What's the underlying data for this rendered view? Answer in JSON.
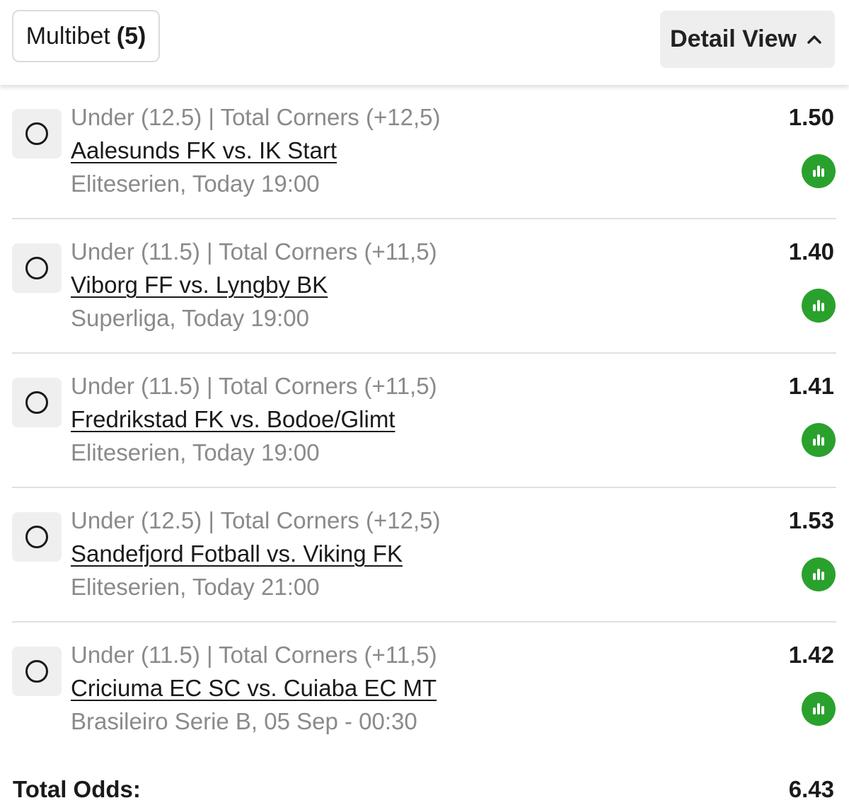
{
  "header": {
    "multibet_label": "Multibet",
    "multibet_count": "(5)",
    "detail_view_label": "Detail View",
    "detail_view_icon": "chevron-up-icon"
  },
  "bets": [
    {
      "selection": "Under (12.5) | Total Corners (+12,5)",
      "match": "Aalesunds FK vs. IK Start",
      "league": "Eliteserien, Today 19:00",
      "odds": "1.50"
    },
    {
      "selection": "Under (11.5) | Total Corners (+11,5)",
      "match": "Viborg FF vs. Lyngby BK",
      "league": "Superliga, Today 19:00",
      "odds": "1.40"
    },
    {
      "selection": "Under (11.5) | Total Corners (+11,5)",
      "match": "Fredrikstad FK vs. Bodoe/Glimt",
      "league": "Eliteserien, Today 19:00",
      "odds": "1.41"
    },
    {
      "selection": "Under (12.5) | Total Corners (+12,5)",
      "match": "Sandefjord Fotball vs. Viking FK",
      "league": "Eliteserien, Today 21:00",
      "odds": "1.53"
    },
    {
      "selection": "Under (11.5) | Total Corners (+11,5)",
      "match": "Criciuma EC SC vs. Cuiaba EC MT",
      "league": "Brasileiro Serie B, 05 Sep - 00:30",
      "odds": "1.42"
    }
  ],
  "footer": {
    "total_label": "Total Odds:",
    "total_value": "6.43"
  },
  "colors": {
    "stats_green": "#2aa12d",
    "muted_text": "#8a8a8a",
    "primary_text": "#1a1a1a"
  },
  "icons": {
    "radio": "radio-unselected-icon",
    "stats": "stats-bar-icon"
  }
}
